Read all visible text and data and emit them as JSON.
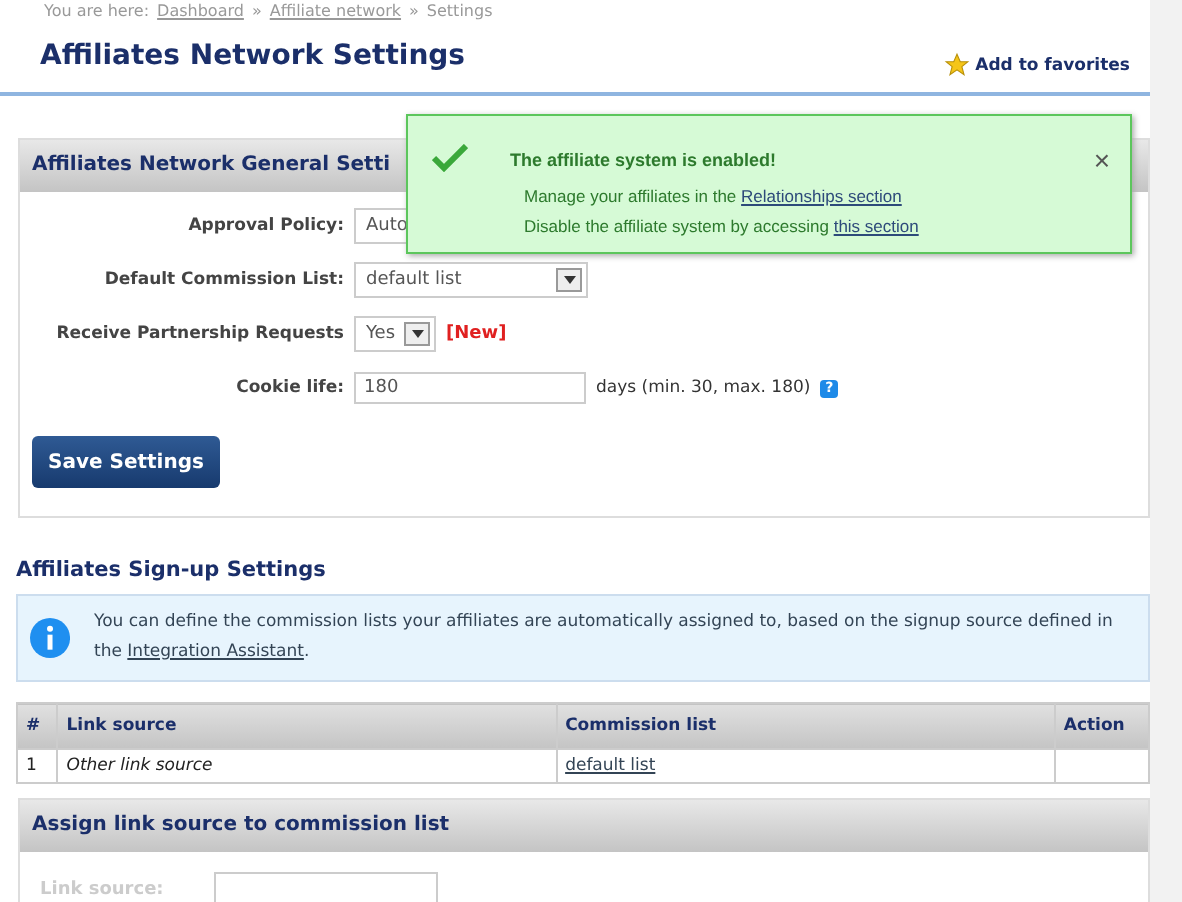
{
  "breadcrumb": {
    "prefix": "You are here:",
    "links": [
      "Dashboard",
      "Affiliate network"
    ],
    "separator": "»",
    "current": "Settings"
  },
  "title": "Affiliates Network Settings",
  "favorites": "Add to favorites",
  "notification": {
    "title": "The affiliate system is enabled!",
    "lines": [
      {
        "text": "Manage your affiliates in the",
        "link": "Relationships section"
      },
      {
        "text": "Disable the affiliate system by accessing",
        "link": "this section"
      }
    ],
    "close": "×"
  },
  "general": {
    "heading": "Affiliates Network General Setti",
    "fields": [
      {
        "kind": "select",
        "label": "Approval Policy:",
        "value": "Auto"
      },
      {
        "kind": "select",
        "label": "Default Commission List:",
        "value": "default list"
      },
      {
        "kind": "toggle",
        "label": "Receive Partnership Requests",
        "value": "Yes",
        "badge": "[New]"
      },
      {
        "kind": "input",
        "label": "Cookie life:",
        "value": "180",
        "suffix": "days (min. 30, max. 180)",
        "help": "?"
      }
    ],
    "save": "Save Settings"
  },
  "signup": {
    "heading": "Affiliates Sign-up Settings",
    "info": "You can define the commission lists your affiliates are automatically assigned to, based on the signup source defined in the",
    "info_link": "Integration Assistant",
    "info_end": ".",
    "columns": [
      "#",
      "Link source",
      "Commission list",
      "Action"
    ],
    "rows": [
      {
        "number": "1",
        "source": "Other link source",
        "list": "default list"
      }
    ]
  },
  "assign": {
    "heading": "Assign link source to commission list",
    "label": "Link source:"
  }
}
